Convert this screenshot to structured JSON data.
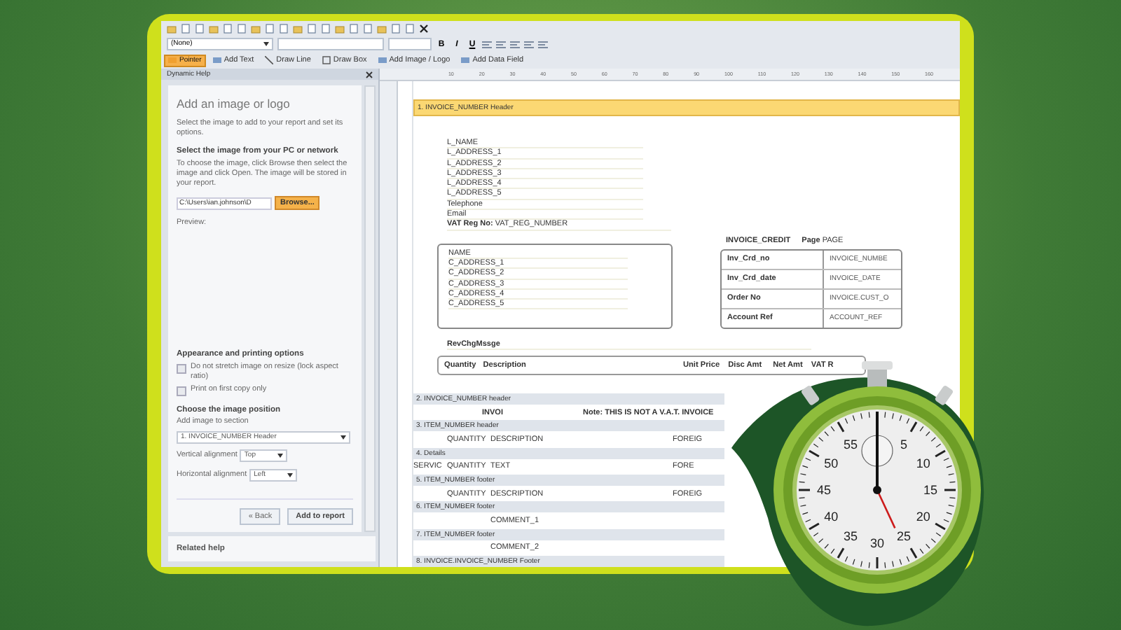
{
  "toolbar": {
    "style_dropdown": {
      "value": "(None)"
    },
    "format_buttons": [
      "B",
      "I",
      "U"
    ],
    "tools": [
      {
        "label": "Pointer",
        "selected": true
      },
      {
        "label": "Add Text",
        "selected": false
      },
      {
        "label": "Draw Line",
        "selected": false
      },
      {
        "label": "Draw Box",
        "selected": false
      },
      {
        "label": "Add Image / Logo",
        "selected": false
      },
      {
        "label": "Add Data Field",
        "selected": false
      }
    ]
  },
  "help_panel": {
    "title": "Dynamic Help",
    "heading": "Add an image or logo",
    "intro": "Select the image to add to your report and set its options.",
    "source_heading": "Select the image from your PC or network",
    "instructions": "To choose the image, click Browse then select the image and click Open. The image will be stored in your report.",
    "path_field": {
      "value": "C:\\Users\\ian.johnson\\D"
    },
    "browse_button": "Browse...",
    "preview_label": "Preview:",
    "options_heading": "Appearance and printing options",
    "checkboxes": [
      {
        "label": "Do not stretch image on resize (lock aspect ratio)",
        "checked": false
      },
      {
        "label": "Print on first copy only",
        "checked": false
      }
    ],
    "position_heading": "Choose the image position",
    "section_label": "Add image to section",
    "section_dropdown": {
      "value": "1. INVOICE_NUMBER Header"
    },
    "alignments": [
      {
        "label": "Vertical alignment",
        "value": "Top"
      },
      {
        "label": "Horizontal alignment",
        "value": "Left"
      }
    ],
    "back_button": "« Back",
    "add_button": "Add to report",
    "related_help": "Related help"
  },
  "ruler": {
    "ticks": [
      "10",
      "20",
      "30",
      "40",
      "50",
      "60",
      "70",
      "80",
      "90",
      "100",
      "110",
      "120",
      "130",
      "140",
      "150",
      "160"
    ]
  },
  "report": {
    "header_band": {
      "title": "1. INVOICE_NUMBER Header",
      "company_lines": [
        "L_NAME",
        "L_ADDRESS_1",
        "L_ADDRESS_2",
        "L_ADDRESS_3",
        "L_ADDRESS_4",
        "L_ADDRESS_5",
        "Telephone",
        "Email"
      ],
      "vat": {
        "label": "VAT Reg No:",
        "value": "VAT_REG_NUMBER"
      },
      "customer_lines": [
        "NAME",
        "C_ADDRESS_1",
        "C_ADDRESS_2",
        "C_ADDRESS_3",
        "C_ADDRESS_4",
        "C_ADDRESS_5"
      ],
      "invoice_type": "INVOICE_CREDIT",
      "page": {
        "label": "Page",
        "value": "PAGE"
      },
      "invoice_rows": [
        {
          "label": "Inv_Crd_no",
          "value": "INVOICE_NUMBE"
        },
        {
          "label": "Inv_Crd_date",
          "value": "INVOICE_DATE"
        },
        {
          "label": "Order No",
          "value": "INVOICE.CUST_O"
        },
        {
          "label": "Account Ref",
          "value": "ACCOUNT_REF"
        }
      ],
      "message_field": "RevChgMssge",
      "columns": [
        "Quantity",
        "Description",
        "Unit Price",
        "Disc Amt",
        "Net Amt",
        "VAT R"
      ]
    },
    "bands": [
      {
        "title": "2. INVOICE_NUMBER header",
        "cells": [
          {
            "kind": "title",
            "text": "INVOI"
          },
          {
            "kind": "note",
            "text": "Note:  THIS IS NOT A V.A.T. INVOICE"
          }
        ]
      },
      {
        "title": "3. ITEM_NUMBER header",
        "cells": [
          {
            "kind": "quantity",
            "text": "QUANTITY"
          },
          {
            "kind": "description",
            "text": "DESCRIPTION"
          },
          {
            "kind": "foreign",
            "text": "FOREIG"
          }
        ]
      },
      {
        "title": "4. Details",
        "cells": [
          {
            "kind": "service",
            "text": "SERVIC"
          },
          {
            "kind": "quantity",
            "text": "QUANTITY"
          },
          {
            "kind": "description",
            "text": "TEXT"
          },
          {
            "kind": "foreign",
            "text": "FORE"
          }
        ]
      },
      {
        "title": "5. ITEM_NUMBER footer",
        "cells": [
          {
            "kind": "quantity",
            "text": "QUANTITY"
          },
          {
            "kind": "description",
            "text": "DESCRIPTION"
          },
          {
            "kind": "foreign",
            "text": "FOREIG"
          }
        ]
      },
      {
        "title": "6. ITEM_NUMBER footer",
        "cells": [
          {
            "kind": "description",
            "text": "COMMENT_1"
          }
        ]
      },
      {
        "title": "7. ITEM_NUMBER footer",
        "cells": [
          {
            "kind": "description",
            "text": "COMMENT_2"
          }
        ]
      },
      {
        "title": "8. INVOICE.INVOICE_NUMBER Footer"
      }
    ]
  },
  "stopwatch": {
    "numbers": [
      "5",
      "10",
      "15",
      "20",
      "25",
      "30",
      "35",
      "40",
      "45",
      "50",
      "55"
    ]
  }
}
